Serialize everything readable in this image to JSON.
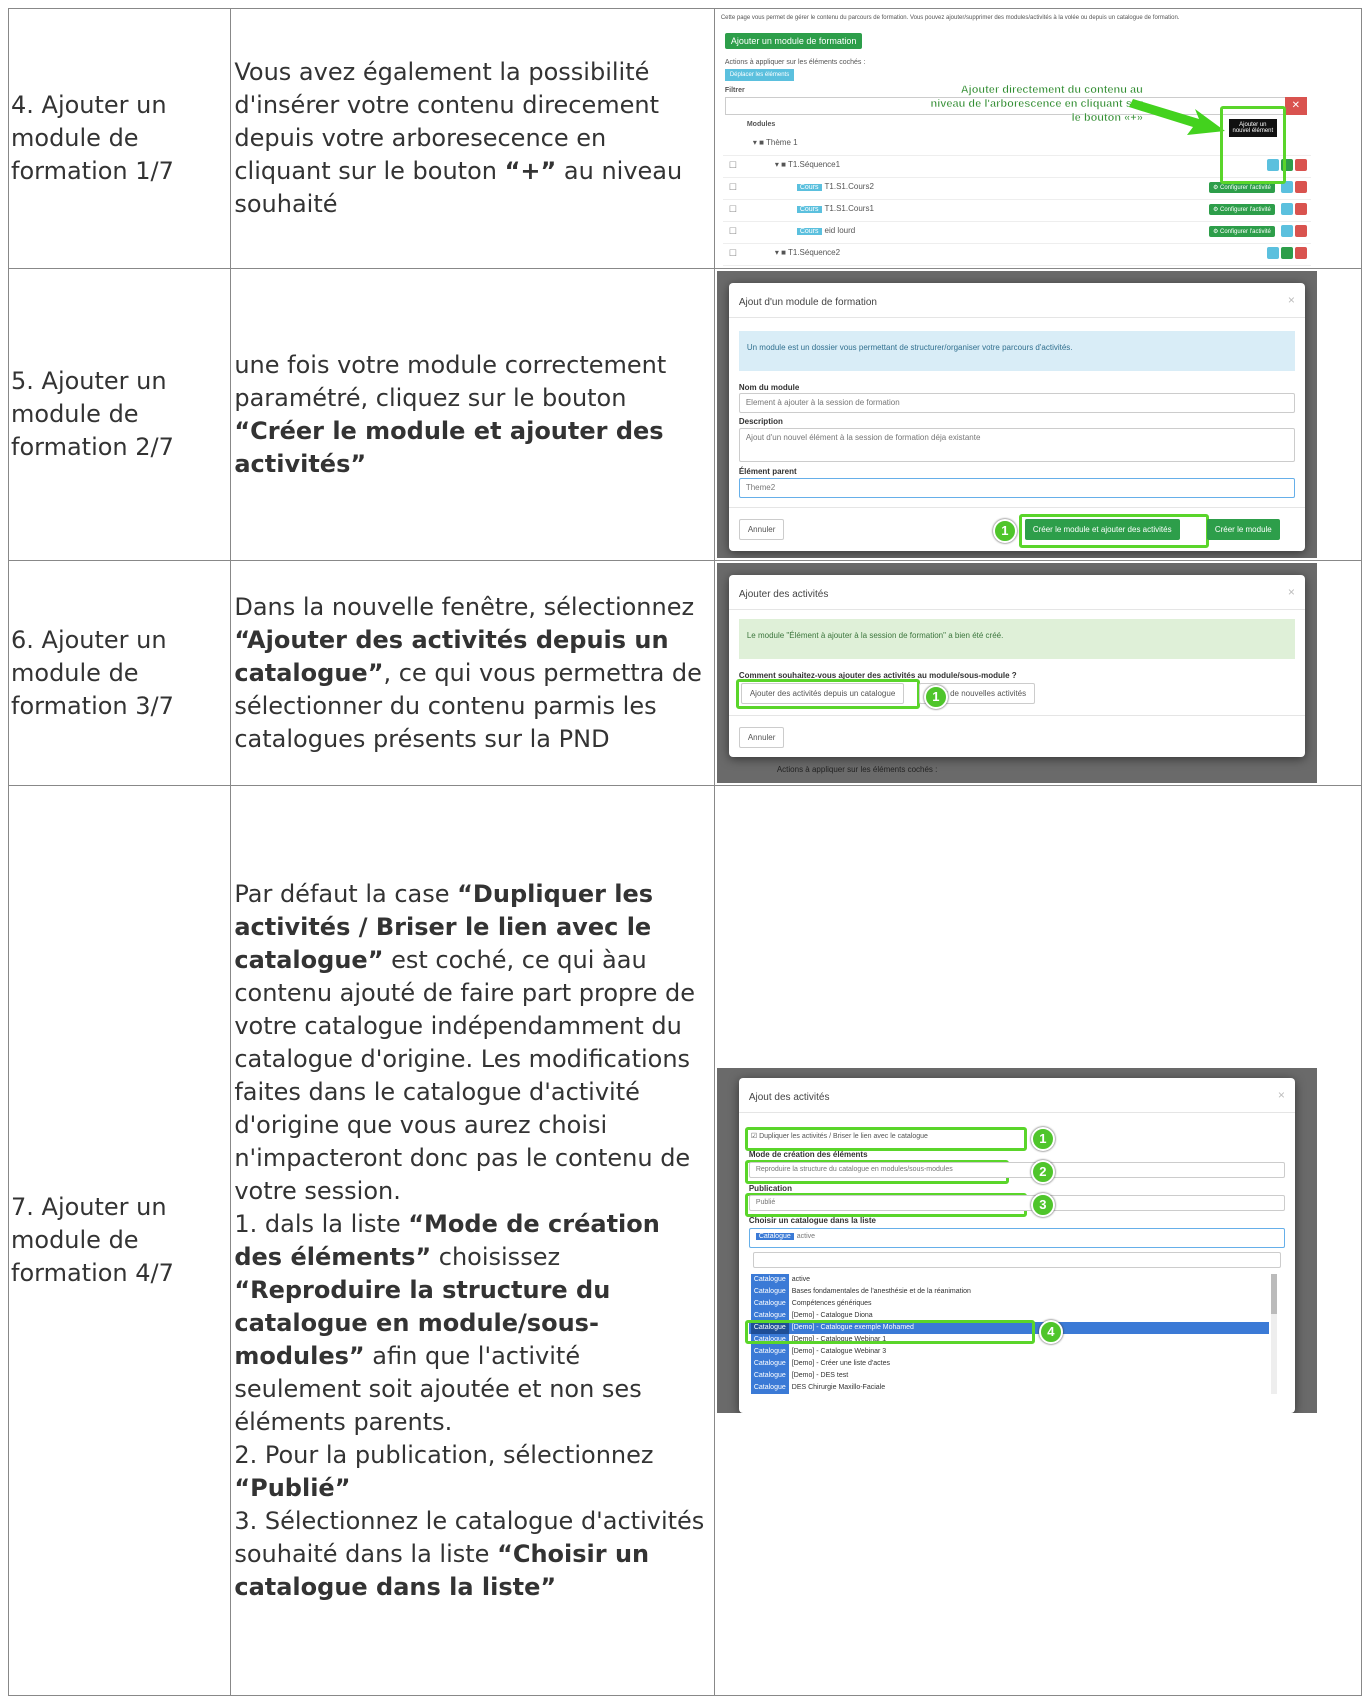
{
  "rows": [
    {
      "step": "4. Ajouter un module de formation 1/7",
      "desc": [
        {
          "t": "Vous avez également la possibilité d'insérer votre contenu direcement depuis votre arboresecence en cliquant sur le bouton ",
          "b": false
        },
        {
          "t": "“+”",
          "b": true
        },
        {
          "t": " au niveau souhaité",
          "b": false
        }
      ]
    },
    {
      "step": "5. Ajouter un module de formation 2/7",
      "desc": [
        {
          "t": "une fois votre module correctement paramétré, cliquez sur le bouton ",
          "b": false
        },
        {
          "t": "“Créer le module et ajouter des activités”",
          "b": true
        }
      ]
    },
    {
      "step": "6. Ajouter un module de formation 3/7",
      "desc": [
        {
          "t": "Dans la nouvelle fenêtre, sélectionnez ",
          "b": false
        },
        {
          "t": "“Ajouter des activités depuis un catalogue”",
          "b": true
        },
        {
          "t": ", ce qui vous permettra de sélectionner du contenu parmis les catalogues présents sur la PND",
          "b": false
        }
      ]
    },
    {
      "step": "7. Ajouter un module de formation 4/7",
      "desc": [
        {
          "t": "Par défaut la case ",
          "b": false
        },
        {
          "t": "“Dupliquer les activités / Briser le lien avec le catalogue”",
          "b": true
        },
        {
          "t": " est coché, ce qui àau contenu ajouté de faire part propre de votre catalogue indépendamment du catalogue d'origine. Les modifications faites dans le catalogue d'activité d'origine que vous aurez choisi n'impacteront donc pas le contenu de votre session.\n1. dals la liste ",
          "b": false
        },
        {
          "t": "“Mode de création des éléments”",
          "b": true
        },
        {
          "t": " choisissez ",
          "b": false
        },
        {
          "t": "“Reproduire la structure du catalogue en module/sous-modules”",
          "b": true
        },
        {
          "t": " afin que l'activité seulement soit ajoutée et non ses éléments parents.\n2. Pour la publication, sélectionnez ",
          "b": false
        },
        {
          "t": "“Publié”",
          "b": true
        },
        {
          "t": "\n3. Sélectionnez le catalogue d'activités souhaité dans la liste ",
          "b": false
        },
        {
          "t": "“Choisir un catalogue dans la liste”",
          "b": true
        }
      ]
    }
  ],
  "shot1": {
    "intro": "Cette page vous permet de gérer le contenu du parcours de formation. Vous pouvez ajouter/supprimer des modules/activités à la volée ou depuis un catalogue de formation.",
    "add_module": "Ajouter un module de formation",
    "actions_label": "Actions à appliquer sur les éléments cochés :",
    "move_btn": "Déplacer les éléments",
    "filter_label": "Filtrer",
    "col_modules": "Modules",
    "callout": "Ajouter directement du contenu au niveau de l'arborescence en cliquant sur le bouton «+»",
    "tooltip": "Ajouter un nouvel élément",
    "tree": [
      {
        "label": "Thème 1",
        "kind": "folder",
        "indent": 0
      },
      {
        "label": "T1.Séquence1",
        "kind": "folder",
        "indent": 1
      },
      {
        "label": "T1.S1.Cours2",
        "kind": "cours",
        "indent": 2
      },
      {
        "label": "T1.S1.Cours1",
        "kind": "cours",
        "indent": 2
      },
      {
        "label": "eid lourd",
        "kind": "cours",
        "indent": 2
      },
      {
        "label": "T1.Séquence2",
        "kind": "folder",
        "indent": 1
      }
    ],
    "configure": "Configurer l'activité",
    "cours_tag": "Cours"
  },
  "shot2": {
    "title": "Ajout d'un module de formation",
    "info": "Un module est un dossier vous permettant de structurer/organiser votre parcours d'activités.",
    "name_label": "Nom du module",
    "name_value": "Element à ajouter à la session de formation",
    "desc_label": "Description",
    "desc_value": "Ajout d'un nouvel élément à la session de formation déja existante",
    "parent_label": "Élément parent",
    "parent_value": "Theme2",
    "cancel": "Annuler",
    "create_add": "Créer le module et ajouter des activités",
    "create": "Créer le module",
    "marker": "1"
  },
  "shot3": {
    "title": "Ajouter des activités",
    "success": "Le module \"Élément à ajouter à la session de formation\" a bien été créé.",
    "question": "Comment souhaitez-vous ajouter des activités au module/sous-module ?",
    "from_catalogue": "Ajouter des activités depuis un catalogue",
    "new_activities": "Créer de nouvelles activités",
    "cancel": "Annuler",
    "below": "Actions à appliquer sur les éléments cochés :",
    "marker": "1"
  },
  "shot4": {
    "title": "Ajout des activités",
    "duplicate": "Dupliquer les activités / Briser le lien avec le catalogue",
    "mode_label": "Mode de création des éléments",
    "mode_value": "Reproduire la structure du catalogue en modules/sous-modules",
    "pub_label": "Publication",
    "pub_value": "Publié",
    "cat_label": "Choisir un catalogue dans la liste",
    "cat_value": "active",
    "tag": "Catalogue",
    "options": [
      "active",
      "Bases fondamentales de l'anesthésie et de la réanimation",
      "Compétences génériques",
      "[Demo] - Catalogue Diona",
      "[Demo] - Catalogue exemple Mohamed",
      "[Demo] - Catalogue Webinar 1",
      "[Demo] - Catalogue Webinar 3",
      "[Demo] - Créer une liste d'actes",
      "[Demo] - DES test",
      "DES Chirurgie Maxillo-Faciale"
    ],
    "selected_index": 4,
    "markers": [
      "1",
      "2",
      "3",
      "4"
    ]
  }
}
